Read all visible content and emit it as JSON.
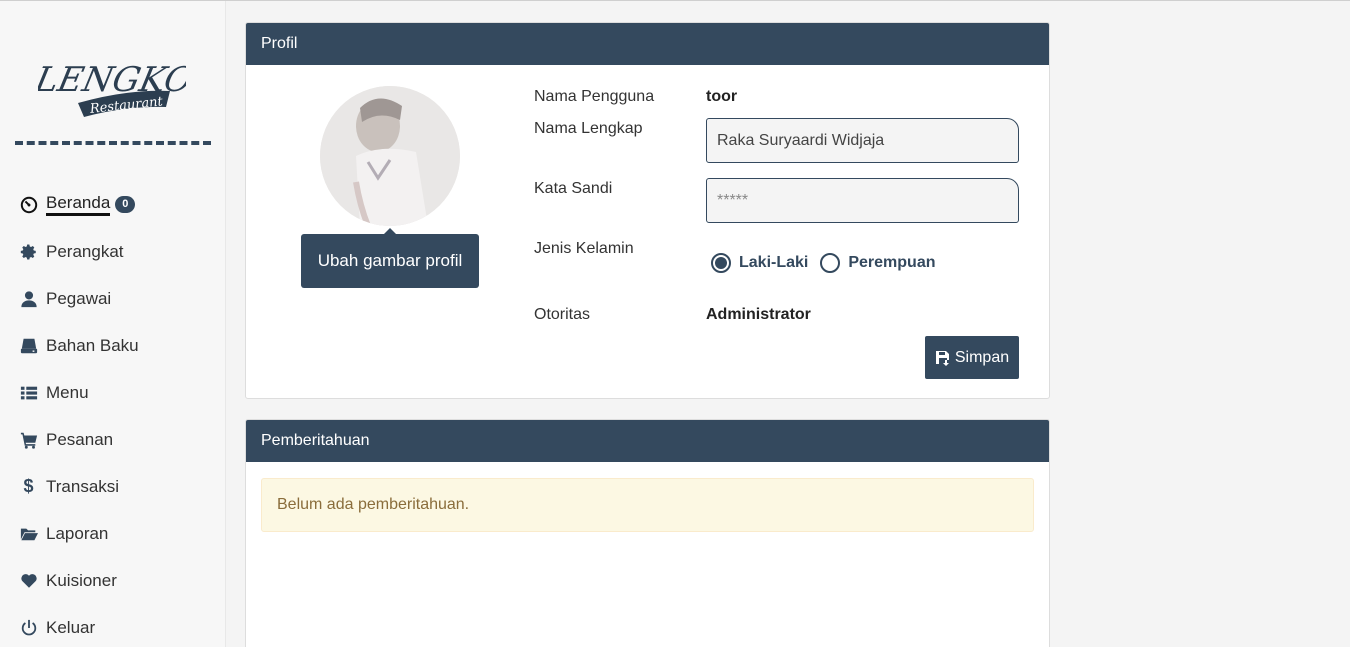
{
  "sidebar": {
    "logo": {
      "main": "LENGKO",
      "sub": "Restaurant"
    },
    "items": [
      {
        "label": "Beranda",
        "icon": "dashboard-icon",
        "badge": "0",
        "active": true
      },
      {
        "label": "Perangkat",
        "icon": "gear-icon"
      },
      {
        "label": "Pegawai",
        "icon": "user-icon"
      },
      {
        "label": "Bahan Baku",
        "icon": "drive-icon"
      },
      {
        "label": "Menu",
        "icon": "list-icon"
      },
      {
        "label": "Pesanan",
        "icon": "cart-icon"
      },
      {
        "label": "Transaksi",
        "icon": "dollar-icon"
      },
      {
        "label": "Laporan",
        "icon": "folder-open-icon"
      },
      {
        "label": "Kuisioner",
        "icon": "heart-icon"
      },
      {
        "label": "Keluar",
        "icon": "power-icon"
      }
    ]
  },
  "profil": {
    "title": "Profil",
    "change_photo": "Ubah gambar profil",
    "username_label": "Nama Pengguna",
    "username": "toor",
    "fullname_label": "Nama Lengkap",
    "fullname": "Raka Suryaardi Widjaja",
    "password_label": "Kata Sandi",
    "password_placeholder": "*****",
    "gender_label": "Jenis Kelamin",
    "gender_options": [
      "Laki-Laki",
      "Perempuan"
    ],
    "gender_selected": "Laki-Laki",
    "role_label": "Otoritas",
    "role": "Administrator",
    "save": "Simpan"
  },
  "notif": {
    "title": "Pemberitahuan",
    "empty": "Belum ada pemberitahuan."
  },
  "colors": {
    "primary": "#34495e",
    "alert_bg": "#fcf8e3",
    "alert_text": "#8a6d3b"
  }
}
